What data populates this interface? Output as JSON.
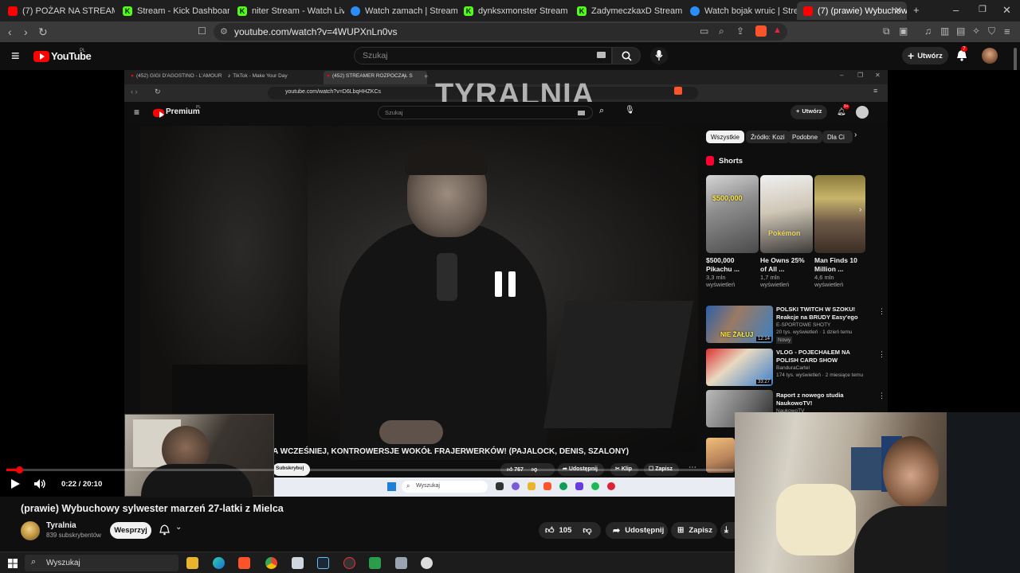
{
  "browser": {
    "tabs": [
      {
        "label": "(7) POŻAR NA STREAMIE! KON",
        "favicon_color": "#ff0000"
      },
      {
        "label": "Stream - Kick Dashboard",
        "favicon_color": "#53fc18"
      },
      {
        "label": "niter Stream - Watch Live on K",
        "favicon_color": "#53fc18"
      },
      {
        "label": "Watch zamach | Streamable",
        "favicon_color": "#2b8df7"
      },
      {
        "label": "dynksxmonster Stream - Watch",
        "favicon_color": "#53fc18"
      },
      {
        "label": "ZadymeczkaxD Stream - Watch",
        "favicon_color": "#53fc18"
      },
      {
        "label": "Watch bojak wruic | Streamable",
        "favicon_color": "#2b8df7"
      },
      {
        "label": "(7) (prawie) Wybuchow",
        "favicon_color": "#ff0000"
      }
    ],
    "new_tab_glyph": "+",
    "url": "youtube.com/watch?v=4WUPXnLn0vs"
  },
  "youtube": {
    "logo_text": "YouTube",
    "logo_region": "PL",
    "search_placeholder": "Szukaj",
    "create_label": "Utwórz",
    "notif_count": "7",
    "video_title": "(prawie) Wybuchowy sylwester marzeń 27-latki z Mielca",
    "channel_name": "Tyralnia",
    "subscribers": "839 subskrybentów",
    "support_label": "Wesprzyj",
    "likes": "105",
    "share_label": "Udostępnij",
    "save_label": "Zapisz",
    "time": "0:22 / 20:10",
    "progress_fraction": 0.018
  },
  "inner_browser": {
    "tabs": [
      "(452) GIGI D'AGOSTINO - L'AMOUR",
      "TikTok - Make Your Day",
      "(452) STREAMER ROZPOCZĄŁ S"
    ],
    "url": "youtube.com/watch?v=D6LbqHHZKCs",
    "watermark": "TYRALNIA",
    "logo_text": "Premium",
    "logo_region": "PL",
    "search_placeholder": "Szukaj",
    "create_label": "Utwórz",
    "notif_count": "9+",
    "chips": [
      "Wszystkie",
      "Źródło: Kozi",
      "Podobne",
      "Dla Ci"
    ],
    "shorts_label": "Shorts",
    "shorts": [
      {
        "title": "$500,000 Pikachu ...",
        "views": "3,3 mln",
        "views2": "wyświetleń",
        "overlay": "$500,000"
      },
      {
        "title": "He Owns 25% of All ...",
        "views": "1,7 mln",
        "views2": "wyświetleń",
        "overlay": "Pokémon"
      },
      {
        "title": "Man Finds 10 Million ...",
        "views": "4,6 mln",
        "views2": "wyświetleń",
        "overlay": ""
      }
    ],
    "recs": [
      {
        "title1": "POLSKI TWITCH W SZOKU!",
        "title2": "Reakcje na BRUDY Easy'ego",
        "channel": "E-SPORTOWE SHOTY",
        "meta": "20 tys. wyświetleń · 1 dzień temu",
        "badge": "Nowy",
        "duration": "12:14",
        "overlay": "NIE ŻAŁUJ"
      },
      {
        "title1": "VLOG - POJECHAŁEM NA",
        "title2": "POLISH CARD SHOW",
        "channel": "BandurаCartel",
        "meta": "174 tys. wyświetleń · 2 miesiące temu",
        "badge": "",
        "duration": "33:27",
        "overlay": ""
      },
      {
        "title1": "Raport z nowego studia",
        "title2": "NaukowoTV!",
        "channel": "NaukowoTV",
        "meta": "",
        "badge": "",
        "duration": "",
        "overlay": ""
      }
    ],
    "caption": "A WCZEŚNIEJ, KONTROWERSJE WOKÓŁ FRAJERWERKÓW! (PAJALOCK, DENIS, SZALONY)",
    "subscribe_label": "Subskrybuj",
    "likes": "767",
    "share_label": "Udostępnij",
    "clip_label": "Klip",
    "save_label": "Zapisz",
    "taskbar_search": "Wyszukaj"
  },
  "taskbar": {
    "search_placeholder": "Wyszukaj"
  }
}
